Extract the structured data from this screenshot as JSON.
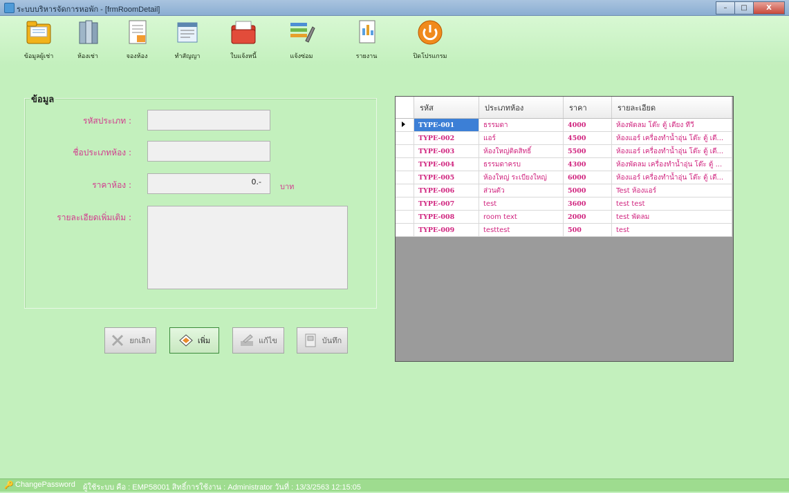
{
  "window": {
    "title": "ระบบบริหารจัดการหอพัก - [frmRoomDetail]",
    "minimize": "–",
    "maximize": "□",
    "close": "X"
  },
  "toolbar": {
    "items": [
      {
        "label": "ข้อมูลผู้เช่า",
        "icon": "folder-icon"
      },
      {
        "label": "ห้องเช่า",
        "icon": "books-icon"
      },
      {
        "label": "จองห้อง",
        "icon": "document-icon"
      },
      {
        "label": "ทำสัญญา",
        "icon": "contract-icon"
      },
      {
        "label": "ใบแจ้งหนี้",
        "icon": "invoice-folder-icon"
      },
      {
        "label": "แจ้งซ่อม",
        "icon": "tools-icon"
      },
      {
        "label": "รายงาน",
        "icon": "report-icon"
      },
      {
        "label": "ปิดโปรแกรม",
        "icon": "power-icon"
      }
    ]
  },
  "form": {
    "group_title": "ข้อมูล",
    "type_code_label": "รหัสประเภท :",
    "type_code_value": "",
    "type_name_label": "ชื่อประเภทห้อง :",
    "type_name_value": "",
    "price_label": "ราคาห้อง :",
    "price_value": "0.-",
    "price_unit": "บาท",
    "detail_label": "รายละเอียดเพิ่มเติม :",
    "detail_value": ""
  },
  "buttons": {
    "cancel": "ยกเลิก",
    "add": "เพิ่ม",
    "edit": "แก้ไข",
    "save": "บันทึก"
  },
  "grid": {
    "columns": [
      "รหัส",
      "ประเภทห้อง",
      "ราคา",
      "รายละเอียด"
    ],
    "rows": [
      [
        "TYPE-001",
        "ธรรมดา",
        "4000",
        "ห้องพัดลม โต๊ะ ตู้ เตียง ทีวี"
      ],
      [
        "TYPE-002",
        "แอร์",
        "4500",
        "ห้องแอร์ เครื่องทำน้ำอุ่น โต๊ะ ตู้ เตี..."
      ],
      [
        "TYPE-003",
        "ห้องใหญ่ติดสิทธิ์",
        "5500",
        "ห้องแอร์ เครื่องทำน้ำอุ่น โต๊ะ ตู้ เตี..."
      ],
      [
        "TYPE-004",
        "ธรรมดาครบ",
        "4300",
        "ห้องพัดลม เครื่องทำน้ำอุ่น โต๊ะ ตู้ ..."
      ],
      [
        "TYPE-005",
        "ห้องใหญ่ ระเบียงใหญ่",
        "6000",
        "ห้องแอร์ เครื่องทำน้ำอุ่น โต๊ะ ตู้ เตี..."
      ],
      [
        "TYPE-006",
        "ส่วนตัว",
        "5000",
        "Test ห้องแอร์"
      ],
      [
        "TYPE-007",
        "test",
        "3600",
        "test test"
      ],
      [
        "TYPE-008",
        "room text",
        "2000",
        "test พัดลม"
      ],
      [
        "TYPE-009",
        "testtest",
        "500",
        "test"
      ]
    ]
  },
  "status": {
    "change_password": "ChangePassword",
    "user_info": "ผู้ใช้ระบบ คือ : EMP58001  สิทธิ์การใช้งาน : Administrator  วันที่ : 13/3/2563 12:15:05"
  }
}
